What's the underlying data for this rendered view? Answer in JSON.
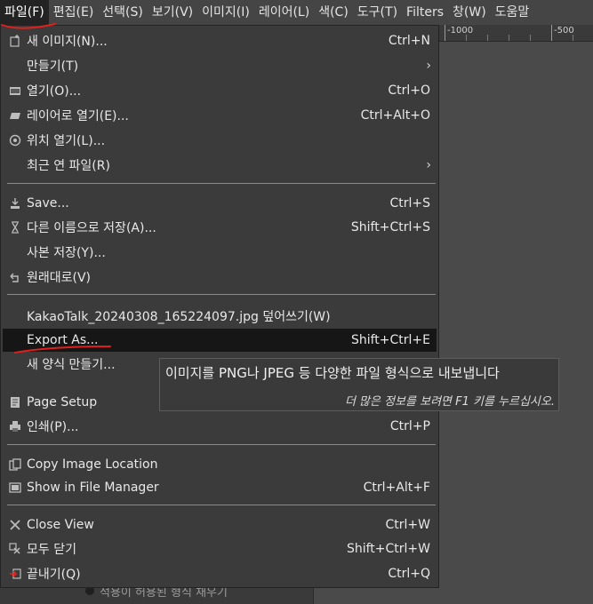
{
  "menubar": {
    "items": [
      {
        "label": "파일(F)",
        "active": true
      },
      {
        "label": "편집(E)"
      },
      {
        "label": "선택(S)"
      },
      {
        "label": "보기(V)"
      },
      {
        "label": "이미지(I)"
      },
      {
        "label": "레이어(L)"
      },
      {
        "label": "색(C)"
      },
      {
        "label": "도구(T)"
      },
      {
        "label": "Filters"
      },
      {
        "label": "창(W)"
      },
      {
        "label": "도움말"
      }
    ]
  },
  "ruler": {
    "labels": [
      "-1000",
      "-500"
    ]
  },
  "file_menu": {
    "items": [
      {
        "label": "새 이미지(N)...",
        "accel": "Ctrl+N",
        "icon": "new-image-icon"
      },
      {
        "label": "만들기(T)",
        "submenu": true
      },
      {
        "label": "열기(O)...",
        "accel": "Ctrl+O",
        "icon": "open-icon"
      },
      {
        "label": "레이어로 열기(E)...",
        "accel": "Ctrl+Alt+O",
        "icon": "open-as-layer-icon"
      },
      {
        "label": "위치 열기(L)...",
        "icon": "open-location-icon"
      },
      {
        "label": "최근 연 파일(R)",
        "submenu": true
      },
      {
        "label": "Save...",
        "accel": "Ctrl+S",
        "icon": "save-icon"
      },
      {
        "label": "다른 이름으로 저장(A)...",
        "accel": "Shift+Ctrl+S",
        "icon": "save-as-icon"
      },
      {
        "label": "사본 저장(Y)..."
      },
      {
        "label": "원래대로(V)",
        "icon": "revert-icon"
      },
      {
        "label": "KakaoTalk_20240308_165224097.jpg 덮어쓰기(W)"
      },
      {
        "label": "Export As...",
        "accel": "Shift+Ctrl+E",
        "highlighted": true
      },
      {
        "label": "새 양식 만들기..."
      },
      {
        "label": "Page Setup",
        "icon": "page-setup-icon"
      },
      {
        "label": "인쇄(P)...",
        "accel": "Ctrl+P",
        "icon": "print-icon"
      },
      {
        "label": "Copy Image Location",
        "icon": "copy-location-icon"
      },
      {
        "label": "Show in File Manager",
        "accel": "Ctrl+Alt+F",
        "icon": "file-manager-icon"
      },
      {
        "label": "Close View",
        "accel": "Ctrl+W",
        "icon": "close-icon"
      },
      {
        "label": "모두 닫기",
        "accel": "Shift+Ctrl+W",
        "icon": "close-all-icon"
      },
      {
        "label": "끝내기(Q)",
        "accel": "Ctrl+Q",
        "icon": "quit-icon"
      }
    ]
  },
  "tooltip": {
    "text": "이미지를 PNG나 JPEG 등 다양한 파일 형식으로 내보냅니다",
    "hint": "더 많은 정보를 보려면 F1 키를 누르십시오."
  },
  "background": {
    "partial_text": "적용이 허용된 형식 채우기"
  },
  "colors": {
    "menu_bg": "#3b3b3b",
    "highlight_bg": "#161616",
    "annotation_red": "#e0201c"
  }
}
